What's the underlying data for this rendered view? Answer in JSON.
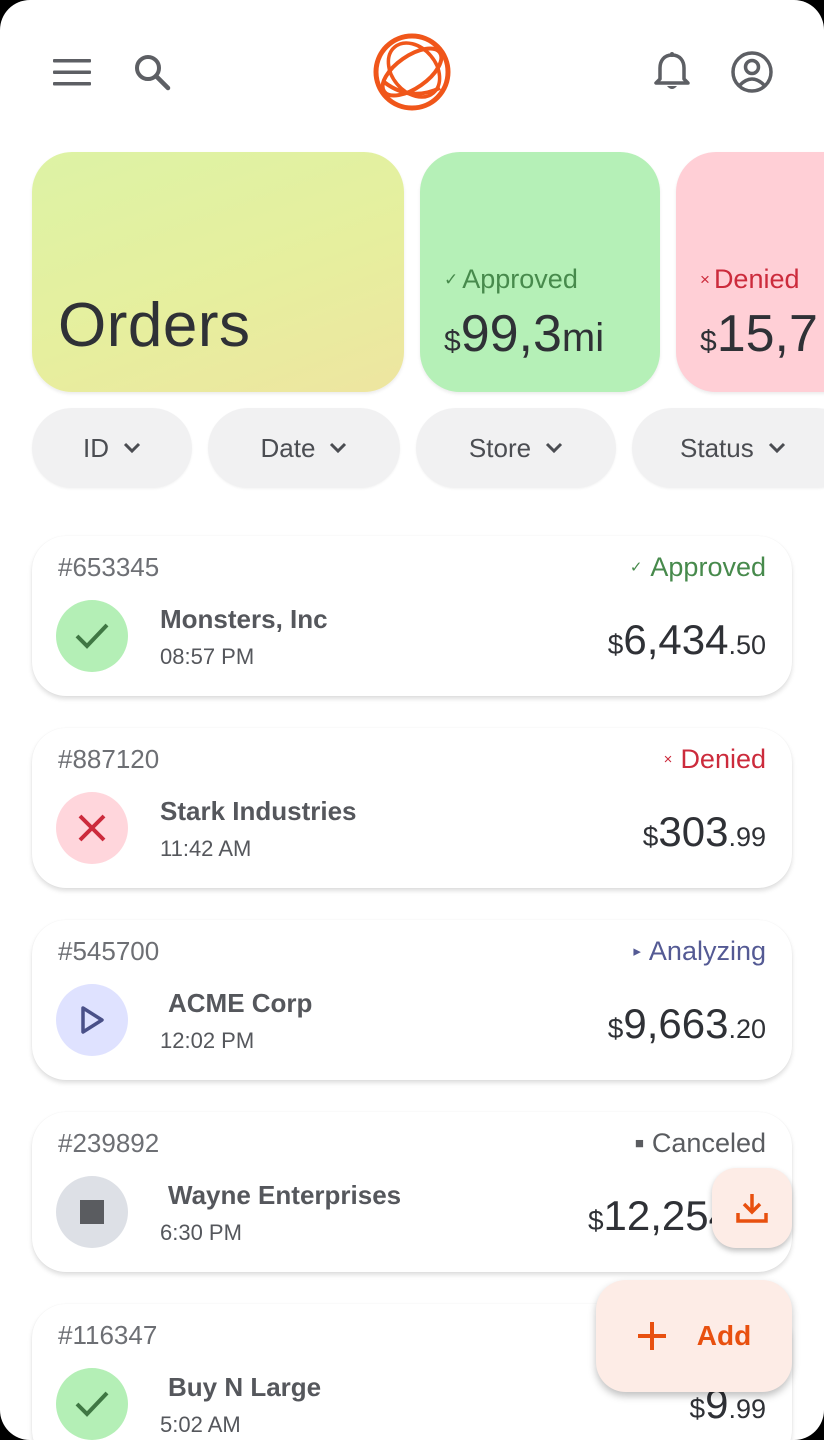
{
  "header": {
    "icons": {
      "menu": "menu-icon",
      "search": "search-icon",
      "logo": "orbit-logo",
      "notifications": "bell-icon",
      "account": "account-circle-icon"
    },
    "accent_color": "#e8500f"
  },
  "summary": {
    "title": "Orders",
    "approved": {
      "mark": "✓",
      "label": "Approved",
      "currency": "$",
      "amount": "99,3",
      "suffix": "mi"
    },
    "denied": {
      "mark": "×",
      "label": "Denied",
      "currency": "$",
      "amount": "15,7"
    }
  },
  "filters": [
    {
      "label": "ID"
    },
    {
      "label": "Date"
    },
    {
      "label": "Store"
    },
    {
      "label": "Status"
    }
  ],
  "orders": [
    {
      "id": "#653345",
      "status": "Approved",
      "status_mark": "✓",
      "customer": "Monsters, Inc",
      "time": "08:57 PM",
      "currency": "$",
      "amount_int": "6,434",
      "amount_cents": ".50",
      "icon": "check-icon"
    },
    {
      "id": "#887120",
      "status": "Denied",
      "status_mark": "×",
      "customer": "Stark Industries",
      "time": "11:42 AM",
      "currency": "$",
      "amount_int": "303",
      "amount_cents": ".99",
      "icon": "close-icon"
    },
    {
      "id": "#545700",
      "status": "Analyzing",
      "status_mark": "▸",
      "customer": "ACME Corp",
      "time": "12:02 PM",
      "currency": "$",
      "amount_int": "9,663",
      "amount_cents": ".20",
      "icon": "play-icon"
    },
    {
      "id": "#239892",
      "status": "Canceled",
      "status_mark": "■",
      "customer": "Wayne Enterprises",
      "time": "6:30 PM",
      "currency": "$",
      "amount_int": "12,254",
      "amount_cents": "",
      "icon": "stop-icon"
    },
    {
      "id": "#116347",
      "status": "",
      "status_mark": "",
      "customer": "Buy N Large",
      "time": "5:02 AM",
      "currency": "$",
      "amount_int": "9",
      "amount_cents": ".99",
      "icon": "check-icon"
    }
  ],
  "fab": {
    "download_icon": "download-icon",
    "add_icon": "plus-icon",
    "add_label": "Add"
  }
}
